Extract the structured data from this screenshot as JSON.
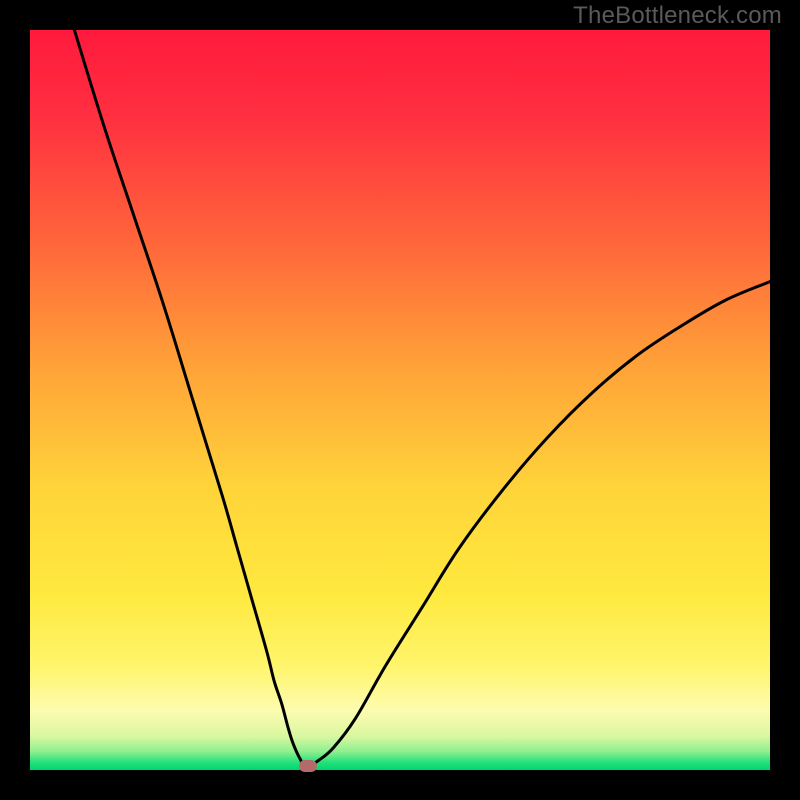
{
  "watermark": "TheBottleneck.com",
  "colors": {
    "frame_border": "#000000",
    "marker": "#b46a6a",
    "curve": "#000000",
    "gradient_stops": [
      {
        "offset": 0.0,
        "color": "#ff1a3d"
      },
      {
        "offset": 0.12,
        "color": "#ff3040"
      },
      {
        "offset": 0.3,
        "color": "#ff6a3a"
      },
      {
        "offset": 0.46,
        "color": "#ffa438"
      },
      {
        "offset": 0.62,
        "color": "#ffd43a"
      },
      {
        "offset": 0.76,
        "color": "#ffe93e"
      },
      {
        "offset": 0.86,
        "color": "#fff56c"
      },
      {
        "offset": 0.92,
        "color": "#fdfcb0"
      },
      {
        "offset": 0.955,
        "color": "#d8f7a0"
      },
      {
        "offset": 0.975,
        "color": "#8ef08e"
      },
      {
        "offset": 0.99,
        "color": "#22e07a"
      },
      {
        "offset": 1.0,
        "color": "#00d670"
      }
    ]
  },
  "chart_data": {
    "type": "line",
    "title": "",
    "xlabel": "",
    "ylabel": "",
    "xlim": [
      0,
      100
    ],
    "ylim": [
      0,
      100
    ],
    "grid": false,
    "legend": false,
    "description": "V-shaped bottleneck curve on a vertical red-to-green heat gradient. Minimum (optimal point) lies near x≈37. Left branch falls steeply from top-left; right branch rises with diminishing slope toward upper right.",
    "series": [
      {
        "name": "bottleneck-curve",
        "x": [
          6,
          10,
          14,
          18,
          22,
          26,
          28,
          30,
          32,
          33,
          34,
          34.8,
          35.4,
          36,
          36.6,
          37,
          37.8,
          39,
          41,
          44,
          48,
          53,
          58,
          64,
          70,
          76,
          82,
          88,
          94,
          100
        ],
        "y": [
          100,
          87,
          75,
          63,
          50,
          37,
          30,
          23,
          16,
          12,
          9,
          6,
          4,
          2.5,
          1.3,
          0.6,
          0.6,
          1.3,
          3,
          7,
          14,
          22,
          30,
          38,
          45,
          51,
          56,
          60,
          63.5,
          66
        ]
      }
    ],
    "marker": {
      "x": 37.5,
      "y": 0.6
    }
  }
}
